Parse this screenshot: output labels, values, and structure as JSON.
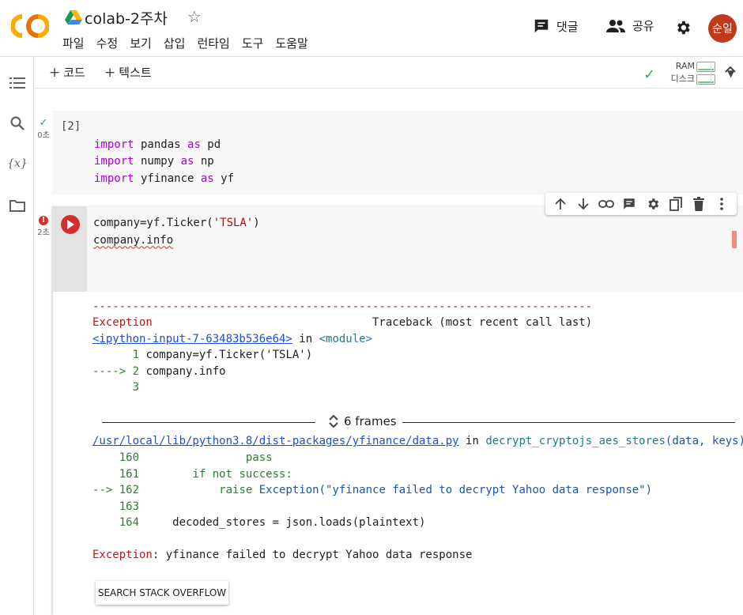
{
  "header": {
    "doc_title": "colab-2주차",
    "menu": [
      "파일",
      "수정",
      "보기",
      "삽입",
      "런타임",
      "도구",
      "도움말"
    ],
    "comment_label": "댓글",
    "share_label": "공유",
    "avatar_text": "순일"
  },
  "toolbar": {
    "code_label": "코드",
    "text_label": "텍스트",
    "ram_label": "RAM",
    "disk_label": "디스크"
  },
  "cell1": {
    "exec_count": "[2]",
    "time": "0초",
    "lines": [
      {
        "kw": "import",
        "rest1": " pandas ",
        "kw2": "as",
        "rest2": " pd"
      },
      {
        "kw": "import",
        "rest1": " numpy ",
        "kw2": "as",
        "rest2": " np"
      },
      {
        "kw": "import",
        "rest1": " yfinance ",
        "kw2": "as",
        "rest2": " yf"
      }
    ]
  },
  "cell2": {
    "time": "2초",
    "line1_pre": "company=yf.Ticker(",
    "line1_str": "'TSLA'",
    "line1_post": ")",
    "line2": "company.info"
  },
  "output": {
    "dashes": "---------------------------------------------------------------------------",
    "exc_name": "Exception",
    "traceback_header": "                                 Traceback (most recent call last)",
    "input_link": "<ipython-input-7-63483b536e64>",
    "in_word": " in ",
    "module": "<module>",
    "tb1_num": "      1",
    "tb1_code": " company=yf.Ticker('TSLA')",
    "tb2_arrow": "----> 2",
    "tb2_code": " company.info",
    "tb3_num": "      3",
    "frames_label": "6 frames",
    "file_link": "/usr/local/lib/python3.8/dist-packages/yfinance/data.py",
    "func_name": "decrypt_cryptojs_aes_stores",
    "func_args": "(data, keys)",
    "l160_num": "    160",
    "l160_code": "                pass",
    "l161_num": "    161",
    "l161_code": "        if not success:",
    "l162_arrow": "--> 162",
    "l162_kw": "            raise",
    "l162_code": " Exception(\"yfinance failed to decrypt Yahoo data response\")",
    "l163_num": "    163",
    "l164_num": "    164",
    "l164_code": "     decoded_stores = json.loads(plaintext)",
    "final_exc": "Exception",
    "final_msg": ": yfinance failed to decrypt Yahoo data response",
    "so_button": "SEARCH STACK OVERFLOW"
  },
  "colors": {
    "keyword": "#af00db",
    "string": "#a31515",
    "error_red": "#b71c1c",
    "line_green": "#2e7d32",
    "link_blue": "#1a4fd8",
    "avatar_bg": "#c0391b",
    "logo_orange": "#f9ab00",
    "ok_green": "#34a853"
  }
}
